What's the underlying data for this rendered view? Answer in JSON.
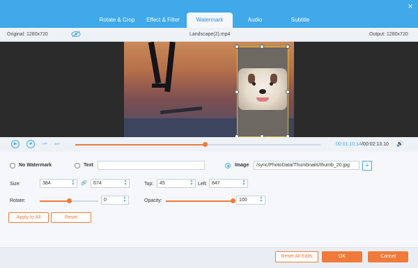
{
  "tabs": [
    {
      "label": "Rotate & Crop"
    },
    {
      "label": "Effect & Filter"
    },
    {
      "label": "Watermark"
    },
    {
      "label": "Audio"
    },
    {
      "label": "Subtitle"
    }
  ],
  "active_tab": "Watermark",
  "close_label": "×",
  "info": {
    "original": "Original: 1280x720",
    "filename": "Landscape(2).mp4",
    "output": "Output: 1280x720"
  },
  "playback": {
    "play_icon": "▶",
    "stop_icon": "■",
    "prev_icon": "⏮",
    "next_icon": "⏭",
    "volume_icon": "🔊",
    "current": "00:01:10.14",
    "total": "/00:02:13.10",
    "progress": 0.53
  },
  "watermark": {
    "no_watermark_label": "No Watermark",
    "text_label": "Text",
    "text_value": "",
    "image_label": "Image",
    "image_path": "/sync/PhotoData/Thumbnails/thumb_20.jpg",
    "add_icon": "+",
    "selected": "Image"
  },
  "size": {
    "label": "Size:",
    "width": "384",
    "height": "674",
    "link_icon": "🔗"
  },
  "position": {
    "top_label": "Top:",
    "top_value": "45",
    "left_label": "Left:",
    "left_value": "847"
  },
  "rotate": {
    "label": "Rotate:",
    "value": "0",
    "level": 0.5
  },
  "opacity": {
    "label": "Opacity:",
    "value": "100",
    "level": 1.0
  },
  "buttons": {
    "apply_all": "Apply to All",
    "reset": "Reset",
    "reset_all": "Reset All Edits",
    "ok": "OK",
    "cancel": "Cancel"
  },
  "colors": {
    "accent": "#3fa9ea",
    "orange": "#f07a3c"
  }
}
